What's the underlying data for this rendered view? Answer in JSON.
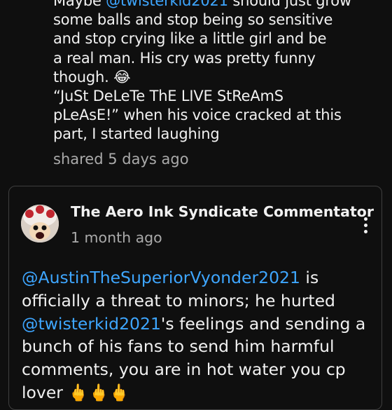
{
  "post": {
    "line1_pre": "Maybe ",
    "line1_mention": "@twisterkid2021",
    "line1_post": " should just grow",
    "line2": "some balls and stop being so sensitive",
    "line3": "and stop crying like a little girl and be",
    "line4": "a real man. His cry was pretty funny",
    "line5": "though. 😂",
    "line6": "“JuSt DeLeTe ThE LIVE StReAmS",
    "line7": "pLeAsE!” when his voice cracked at this",
    "line8": "part, I started laughing",
    "shared": "shared 5 days ago"
  },
  "comment": {
    "author": "The Aero Ink Syndicate Commentator",
    "time": "1 month ago",
    "menu_icon": "more-vert-icon",
    "l1_mention": "@AustinTheSuperiorVyonder2021",
    "l1_post": " is",
    "l2": "officially a threat to minors; he hurted",
    "l3_mention": "@twisterkid2021",
    "l3_post": "'s feelings and sending a",
    "l4": "bunch of his fans to send him harmful",
    "l5": "comments, you are in hot water you cp",
    "l6": "lover 🖕🖕🖕"
  },
  "colors": {
    "background": "#0f0f0f",
    "text": "#f1f1f1",
    "secondary": "#aaaaaa",
    "link": "#3ea6ff",
    "card_border": "#3f3f3f"
  }
}
